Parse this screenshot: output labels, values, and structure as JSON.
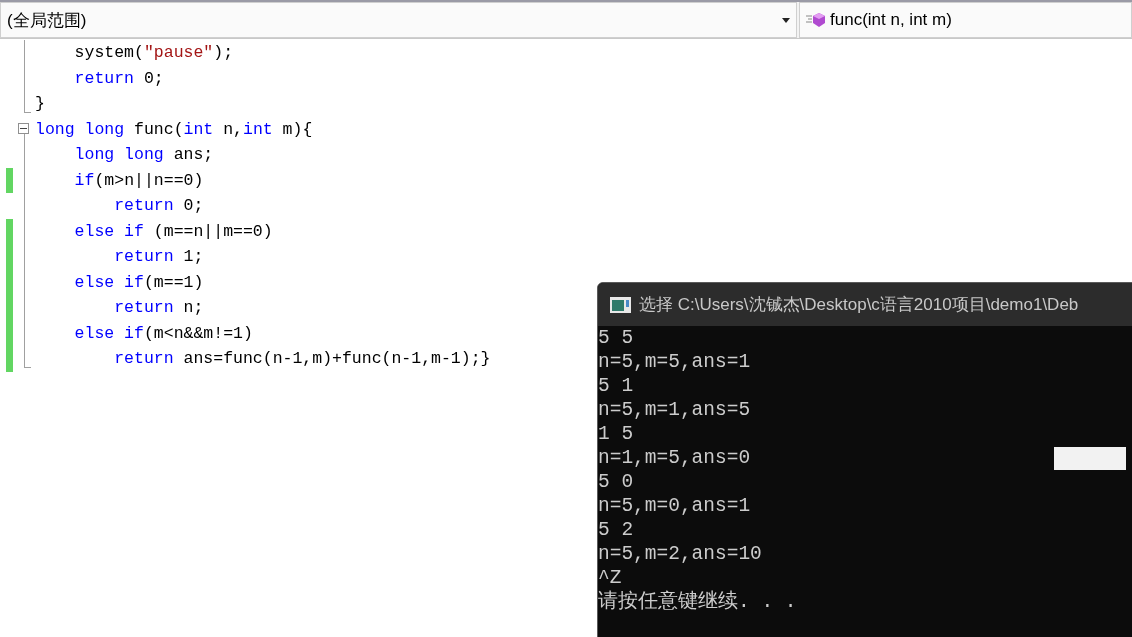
{
  "navigation_bar": {
    "scope": "(全局范围)",
    "member": "func(int n, int m)"
  },
  "code_lines": [
    {
      "fold_start": false,
      "changed": false,
      "tokens": [
        {
          "kind": "plain",
          "text": "    system("
        },
        {
          "kind": "string",
          "text": "\"pause\""
        },
        {
          "kind": "plain",
          "text": ");"
        }
      ]
    },
    {
      "fold_start": false,
      "changed": false,
      "tokens": [
        {
          "kind": "keyword",
          "text": "    return"
        },
        {
          "kind": "plain",
          "text": " 0;"
        }
      ]
    },
    {
      "fold_start": false,
      "changed": false,
      "tokens": [
        {
          "kind": "plain",
          "text": "}"
        }
      ]
    },
    {
      "fold_start": true,
      "changed": false,
      "tokens": [
        {
          "kind": "keyword",
          "text": "long long"
        },
        {
          "kind": "plain",
          "text": " func("
        },
        {
          "kind": "keyword",
          "text": "int"
        },
        {
          "kind": "plain",
          "text": " n,"
        },
        {
          "kind": "keyword",
          "text": "int"
        },
        {
          "kind": "plain",
          "text": " m){"
        }
      ]
    },
    {
      "fold_start": false,
      "changed": false,
      "tokens": [
        {
          "kind": "keyword",
          "text": "    long long"
        },
        {
          "kind": "plain",
          "text": " ans;"
        }
      ]
    },
    {
      "fold_start": false,
      "changed": true,
      "tokens": [
        {
          "kind": "keyword",
          "text": "    if"
        },
        {
          "kind": "plain",
          "text": "(m>n||n==0)"
        }
      ]
    },
    {
      "fold_start": false,
      "changed": false,
      "tokens": [
        {
          "kind": "keyword",
          "text": "        return"
        },
        {
          "kind": "plain",
          "text": " 0;"
        }
      ]
    },
    {
      "fold_start": false,
      "changed": true,
      "tokens": [
        {
          "kind": "keyword",
          "text": "    else if"
        },
        {
          "kind": "plain",
          "text": " (m==n||m==0)"
        }
      ]
    },
    {
      "fold_start": false,
      "changed": true,
      "tokens": [
        {
          "kind": "keyword",
          "text": "        return"
        },
        {
          "kind": "plain",
          "text": " 1;"
        }
      ]
    },
    {
      "fold_start": false,
      "changed": true,
      "tokens": [
        {
          "kind": "keyword",
          "text": "    else if"
        },
        {
          "kind": "plain",
          "text": "(m==1)"
        }
      ]
    },
    {
      "fold_start": false,
      "changed": true,
      "tokens": [
        {
          "kind": "keyword",
          "text": "        return"
        },
        {
          "kind": "plain",
          "text": " n;"
        }
      ]
    },
    {
      "fold_start": false,
      "changed": true,
      "tokens": [
        {
          "kind": "keyword",
          "text": "    else if"
        },
        {
          "kind": "plain",
          "text": "(m<n&&m!=1)"
        }
      ]
    },
    {
      "fold_start": false,
      "changed": true,
      "tokens": [
        {
          "kind": "keyword",
          "text": "        return"
        },
        {
          "kind": "plain",
          "text": " ans=func(n-1,m)+func(n-1,m-1);}"
        }
      ]
    }
  ],
  "console": {
    "title": "选择 C:\\Users\\沈铖杰\\Desktop\\c语言2010项目\\demo1\\Deb",
    "lines": [
      "5 5",
      "n=5,m=5,ans=1",
      "5 1",
      "n=5,m=1,ans=5",
      "1 5",
      "n=1,m=5,ans=0",
      "5 0",
      "n=5,m=0,ans=1",
      "5 2",
      "n=5,m=2,ans=10",
      "^Z",
      "请按任意键继续. . ."
    ]
  }
}
